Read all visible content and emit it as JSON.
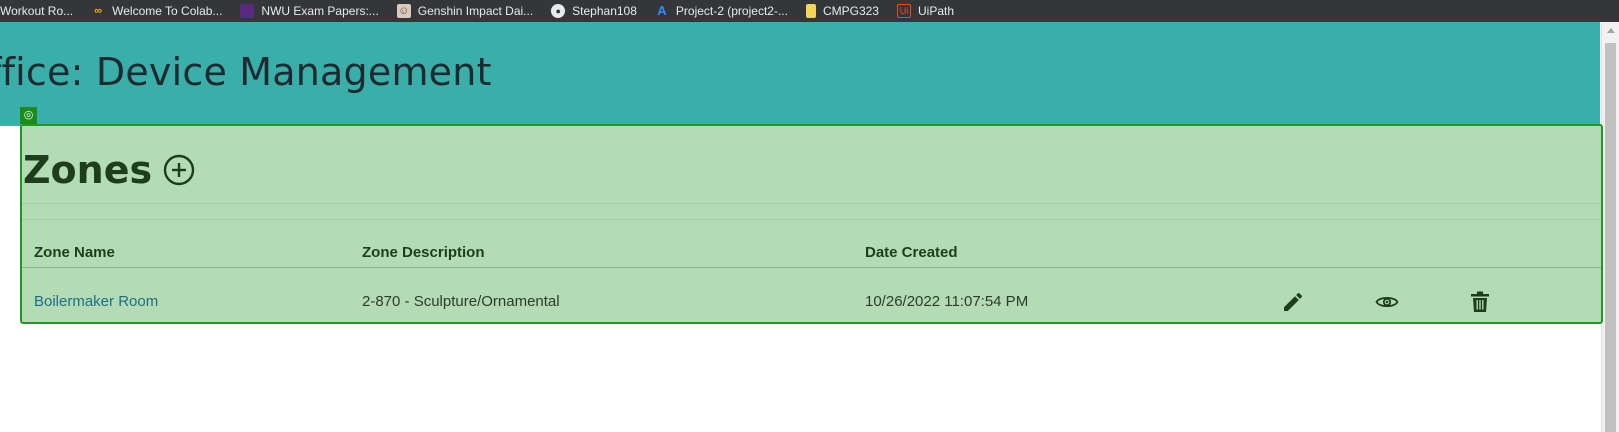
{
  "bookmarks": [
    {
      "label": "Workout Ro...",
      "icon": "none"
    },
    {
      "label": "Welcome To Colab...",
      "icon": "colab-icon"
    },
    {
      "label": "NWU Exam Papers:...",
      "icon": "nwu-icon"
    },
    {
      "label": "Genshin Impact Dai...",
      "icon": "genshin-icon"
    },
    {
      "label": "Stephan108",
      "icon": "github-icon"
    },
    {
      "label": "Project-2 (project2-...",
      "icon": "azure-icon"
    },
    {
      "label": "CMPG323",
      "icon": "folder-icon"
    },
    {
      "label": "UiPath",
      "icon": "uipath-icon"
    }
  ],
  "header": {
    "title": "ffice: Device Management"
  },
  "zones": {
    "title": "Zones",
    "columns": [
      "Zone Name",
      "Zone Description",
      "Date Created"
    ],
    "rows": [
      {
        "name": "Boilermaker Room",
        "description": "2-870 - Sculpture/Ornamental",
        "date": "10/26/2022 11:07:54 PM"
      }
    ]
  },
  "colors": {
    "header_bg": "#3aafa9",
    "panel_bg": "#b4dcb4",
    "panel_border": "#1f9a1f",
    "link": "#1f6d88"
  }
}
